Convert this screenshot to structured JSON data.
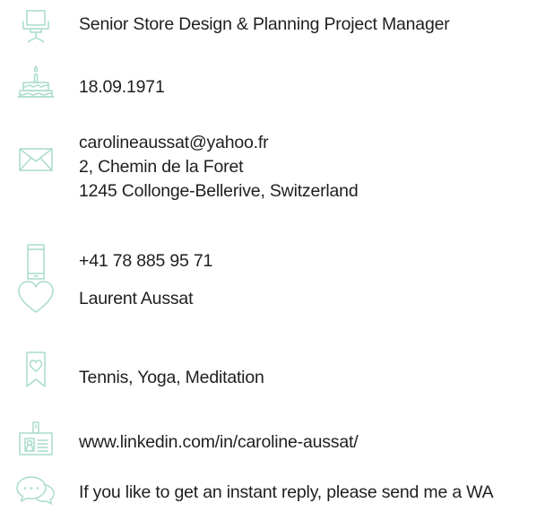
{
  "accent_color": "#a9dccb",
  "items": [
    {
      "icon": "office-chair-icon",
      "lines": [
        "Senior Store Design & Planning Project Manager"
      ]
    },
    {
      "icon": "birthday-cake-icon",
      "lines": [
        "18.09.1971"
      ]
    },
    {
      "icon": "envelope-icon",
      "lines": [
        "carolineaussat@yahoo.fr",
        "2, Chemin de la Foret",
        "1245 Collonge-Bellerive, Switzerland"
      ]
    },
    {
      "icon": "smartphone-icon",
      "lines": [
        "+41 78 885 95 71"
      ]
    },
    {
      "icon": "heart-icon",
      "lines": [
        "Laurent Aussat"
      ]
    },
    {
      "icon": "bookmark-heart-icon",
      "lines": [
        "Tennis, Yoga, Meditation"
      ]
    },
    {
      "icon": "id-badge-icon",
      "lines": [
        "www.linkedin.com/in/caroline-aussat/"
      ]
    },
    {
      "icon": "chat-bubbles-icon",
      "lines": [
        "If you like to get an instant reply, please send me a WA"
      ]
    }
  ]
}
